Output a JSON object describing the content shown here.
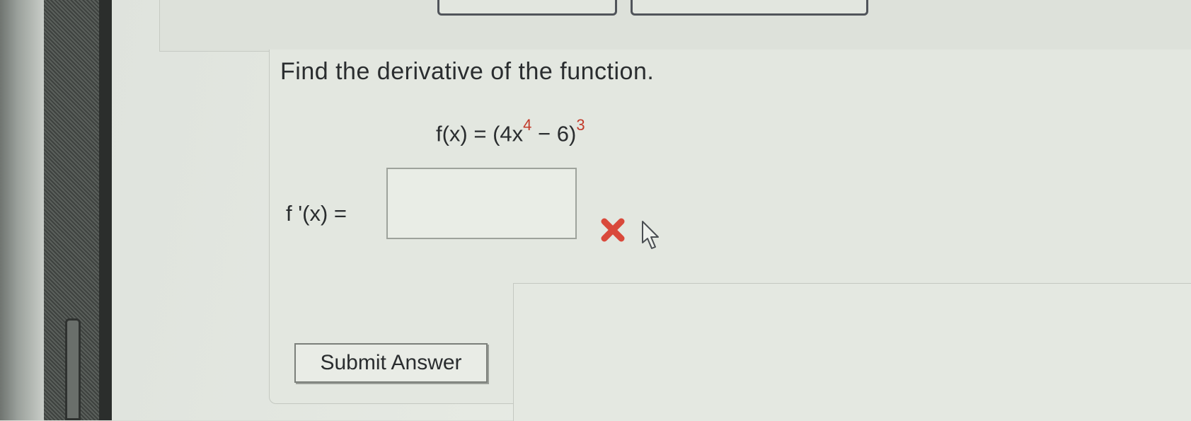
{
  "question": {
    "prompt": "Find the derivative of the function."
  },
  "function": {
    "lhs": "f(x) = (4x",
    "exponent_inner": "4",
    "middle": " − 6)",
    "exponent_outer": "3"
  },
  "answer": {
    "label": "f '(x) =",
    "value": "",
    "status": "incorrect"
  },
  "actions": {
    "submit_label": "Submit Answer"
  },
  "colors": {
    "error_red": "#d9493b",
    "exponent_red": "#c23a2a",
    "text": "#2a2d2f"
  }
}
